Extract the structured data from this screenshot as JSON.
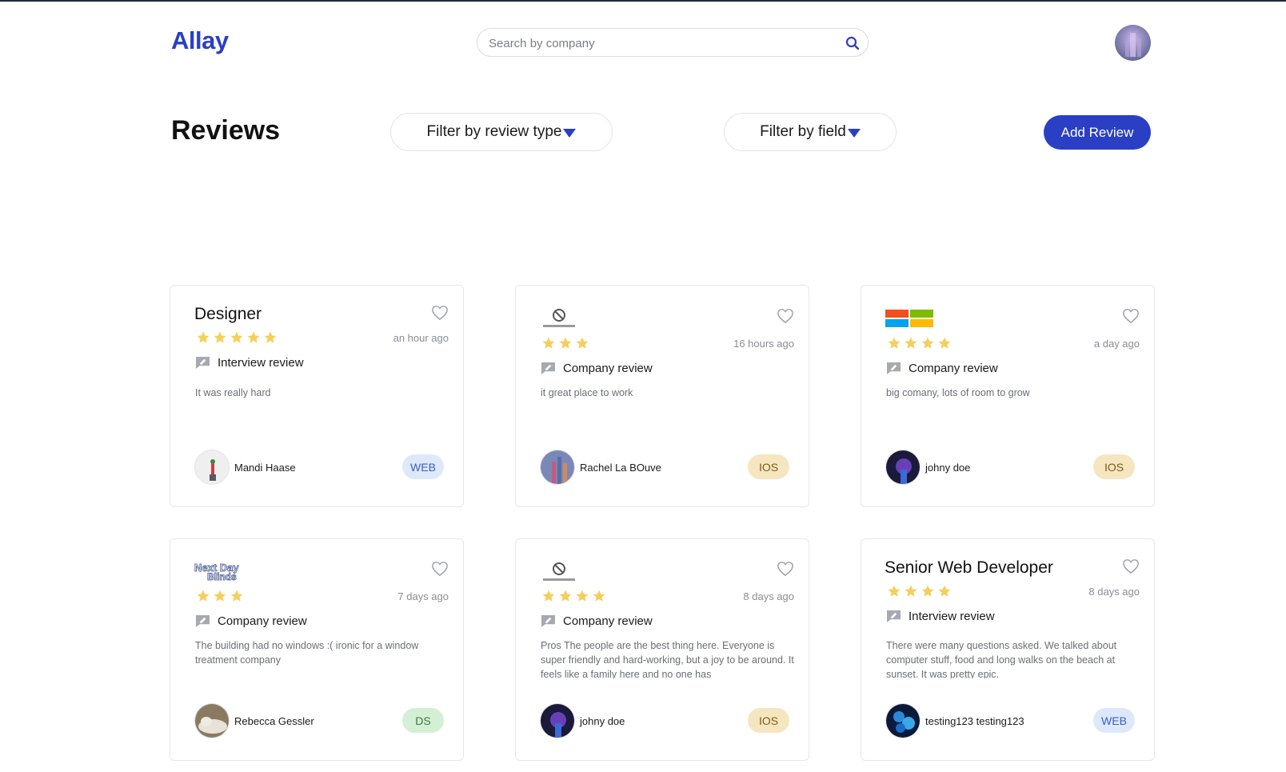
{
  "header": {
    "logo": "Allay",
    "search": {
      "placeholder": "Search by company",
      "value": ""
    }
  },
  "toolbar": {
    "title": "Reviews",
    "filter_type_label": "Filter by review type",
    "filter_field_label": "Filter by field",
    "add_label": "Add Review"
  },
  "colors": {
    "accent": "#2a3fc4",
    "star": "#f5cf5a",
    "badge_web_bg": "#dde9fb",
    "badge_ios_bg": "#f6e6bf",
    "badge_ds_bg": "#d3f0d4"
  },
  "cards": [
    {
      "title": "Designer",
      "stars": 5,
      "time": "an hour ago",
      "type": "Interview review",
      "text": "It was really hard",
      "author": "Mandi Haase",
      "badge": "WEB"
    },
    {
      "logo": "no-logo-available",
      "stars": 3,
      "time": "16 hours ago",
      "type": "Company review",
      "text": "it great place to work",
      "author": "Rachel La BOuve",
      "badge": "IOS"
    },
    {
      "logo": "microsoft-logo",
      "stars": 4,
      "time": "a day ago",
      "type": "Company review",
      "text": "big comany, lots of room to grow",
      "author": "johny doe",
      "badge": "IOS"
    },
    {
      "logo": "next-day-blinds-logo",
      "stars": 3,
      "time": "7 days ago",
      "type": "Company review",
      "text": "The building had no windows :( ironic for a window treatment company",
      "author": "Rebecca Gessler",
      "badge": "DS"
    },
    {
      "logo": "no-logo-available",
      "stars": 4,
      "time": "8 days ago",
      "type": "Company review",
      "text": "Pros The people are the best thing here. Everyone is super friendly and hard-working, but a joy to be around. It feels like a family here and no one has",
      "author": "johny doe",
      "badge": "IOS"
    },
    {
      "title": "Senior Web Developer",
      "stars": 4,
      "time": "8 days ago",
      "type": "Interview review",
      "text": "There were many questions asked. We talked about computer stuff, food and long walks on the beach at sunset. It was pretty epic.",
      "author": "testing123 testing123",
      "badge": "WEB"
    }
  ]
}
